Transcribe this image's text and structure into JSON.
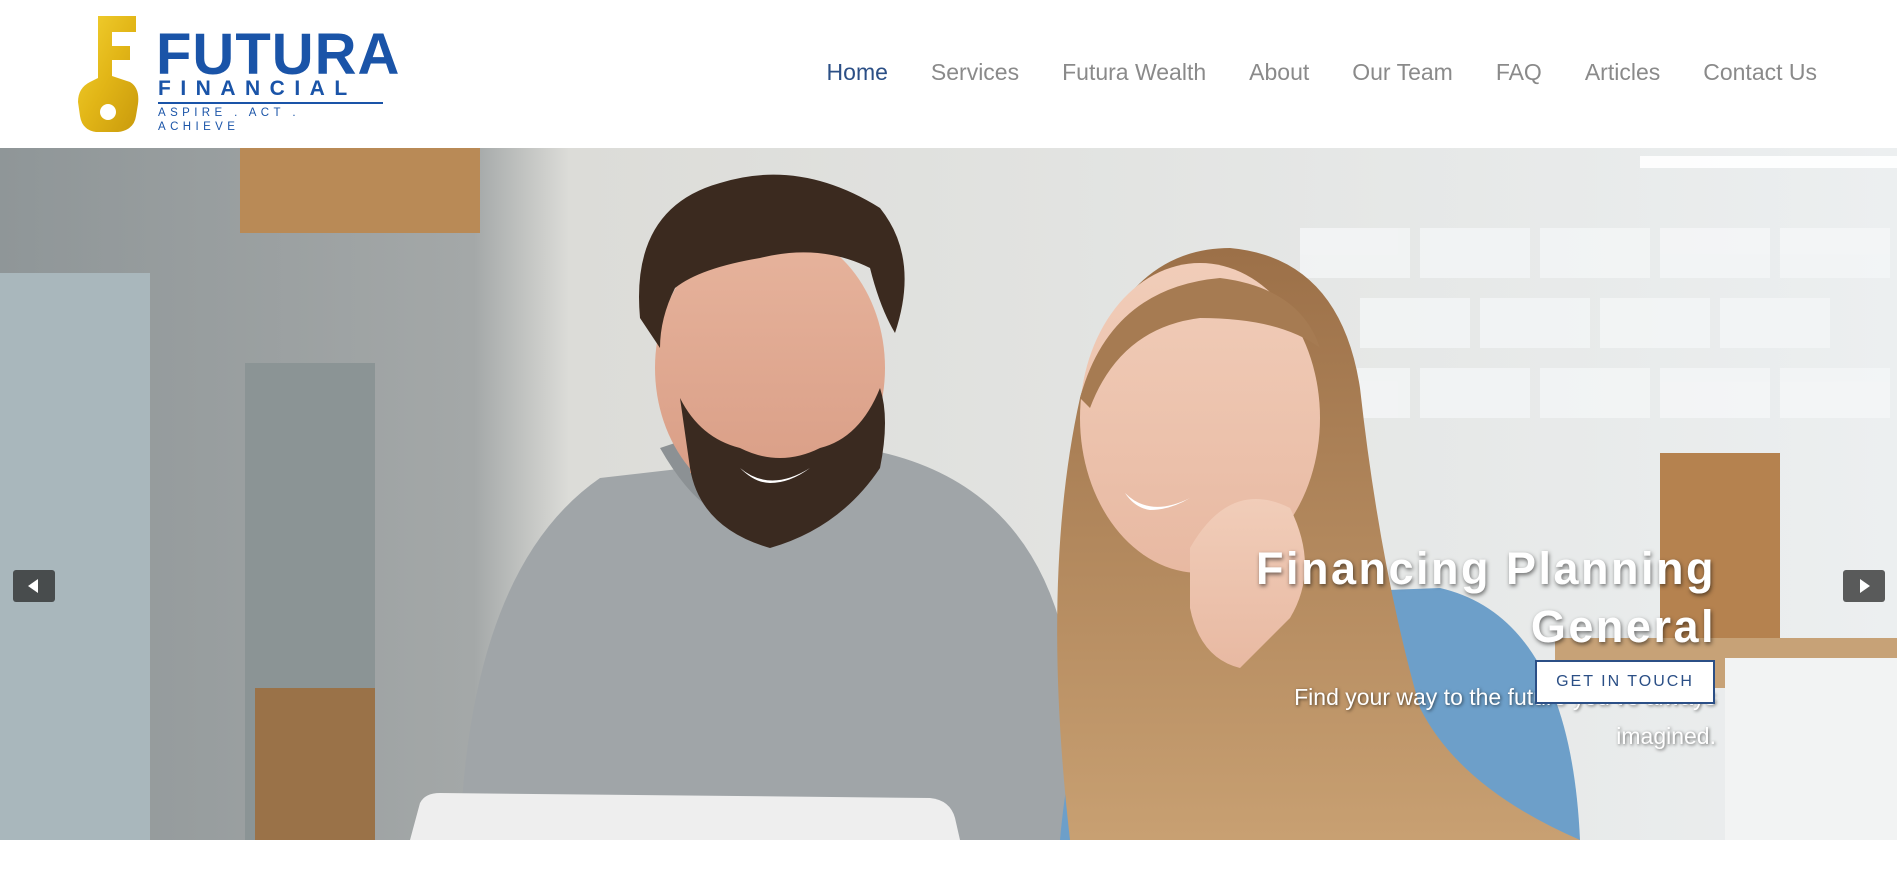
{
  "brand": {
    "name": "FUTURA",
    "subname": "FINANCIAL",
    "tagline": "ASPIRE . ACT . ACHIEVE",
    "colors": {
      "primary": "#1a54a8",
      "gold": "#e2b617"
    },
    "logo_icon": "key-f-icon"
  },
  "nav": {
    "items": [
      {
        "label": "Home",
        "active": true
      },
      {
        "label": "Services",
        "active": false
      },
      {
        "label": "Futura Wealth",
        "active": false
      },
      {
        "label": "About",
        "active": false
      },
      {
        "label": "Our Team",
        "active": false
      },
      {
        "label": "FAQ",
        "active": false
      },
      {
        "label": "Articles",
        "active": false
      },
      {
        "label": "Contact Us",
        "active": false
      }
    ],
    "colors": {
      "active": "#2b4f86",
      "inactive": "#8a8a8a"
    }
  },
  "hero": {
    "title_line1": "Financing Planning",
    "title_line2": "General",
    "subtitle_line1": "Find your way to the future you’ve always",
    "subtitle_line2": "imagined.",
    "cta_label": "GET IN TOUCH",
    "prev_icon": "triangle-left-icon",
    "next_icon": "triangle-right-icon"
  }
}
